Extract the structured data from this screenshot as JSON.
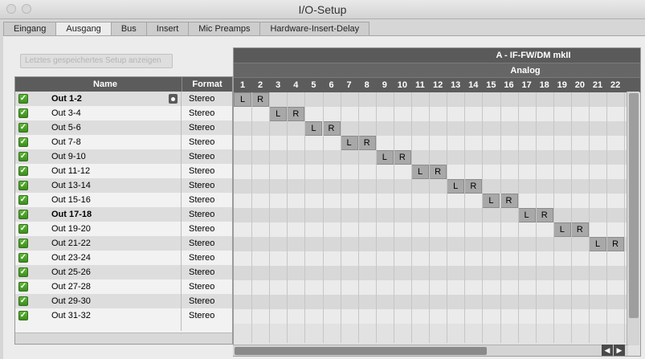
{
  "window": {
    "title": "I/O-Setup"
  },
  "tabs": [
    "Eingang",
    "Ausgang",
    "Bus",
    "Insert",
    "Mic Preamps",
    "Hardware-Insert-Delay"
  ],
  "active_tab": "Ausgang",
  "setup_button": {
    "label": "Letztes gespeichertes Setup anzeigen"
  },
  "table": {
    "col_name": "Name",
    "col_format": "Format",
    "rows": [
      {
        "name": "Out 1-2",
        "format": "Stereo",
        "bold": true,
        "locked": true,
        "checked": true
      },
      {
        "name": "Out 3-4",
        "format": "Stereo",
        "bold": false,
        "locked": false,
        "checked": true
      },
      {
        "name": "Out 5-6",
        "format": "Stereo",
        "bold": false,
        "locked": false,
        "checked": true
      },
      {
        "name": "Out 7-8",
        "format": "Stereo",
        "bold": false,
        "locked": false,
        "checked": true
      },
      {
        "name": "Out 9-10",
        "format": "Stereo",
        "bold": false,
        "locked": false,
        "checked": true
      },
      {
        "name": "Out 11-12",
        "format": "Stereo",
        "bold": false,
        "locked": false,
        "checked": true
      },
      {
        "name": "Out 13-14",
        "format": "Stereo",
        "bold": false,
        "locked": false,
        "checked": true
      },
      {
        "name": "Out 15-16",
        "format": "Stereo",
        "bold": false,
        "locked": false,
        "checked": true
      },
      {
        "name": "Out 17-18",
        "format": "Stereo",
        "bold": true,
        "locked": false,
        "checked": true
      },
      {
        "name": "Out 19-20",
        "format": "Stereo",
        "bold": false,
        "locked": false,
        "checked": true
      },
      {
        "name": "Out 21-22",
        "format": "Stereo",
        "bold": false,
        "locked": false,
        "checked": true
      },
      {
        "name": "Out 23-24",
        "format": "Stereo",
        "bold": false,
        "locked": false,
        "checked": true
      },
      {
        "name": "Out 25-26",
        "format": "Stereo",
        "bold": false,
        "locked": false,
        "checked": true
      },
      {
        "name": "Out 27-28",
        "format": "Stereo",
        "bold": false,
        "locked": false,
        "checked": true
      },
      {
        "name": "Out 29-30",
        "format": "Stereo",
        "bold": false,
        "locked": false,
        "checked": true
      },
      {
        "name": "Out 31-32",
        "format": "Stereo",
        "bold": false,
        "locked": false,
        "checked": true
      }
    ]
  },
  "grid": {
    "device": "A - IF-FW/DM mkII",
    "group": "Analog",
    "channels": [
      "1",
      "2",
      "3",
      "4",
      "5",
      "6",
      "7",
      "8",
      "9",
      "10",
      "11",
      "12",
      "13",
      "14",
      "15",
      "16",
      "17",
      "18",
      "19",
      "20",
      "21",
      "22"
    ],
    "left_label": "L",
    "right_label": "R",
    "assignments": [
      {
        "row": 0,
        "l": 1,
        "r": 2
      },
      {
        "row": 1,
        "l": 3,
        "r": 4
      },
      {
        "row": 2,
        "l": 5,
        "r": 6
      },
      {
        "row": 3,
        "l": 7,
        "r": 8
      },
      {
        "row": 4,
        "l": 9,
        "r": 10
      },
      {
        "row": 5,
        "l": 11,
        "r": 12
      },
      {
        "row": 6,
        "l": 13,
        "r": 14
      },
      {
        "row": 7,
        "l": 15,
        "r": 16
      },
      {
        "row": 8,
        "l": 17,
        "r": 18
      },
      {
        "row": 9,
        "l": 19,
        "r": 20
      },
      {
        "row": 10,
        "l": 21,
        "r": 22
      }
    ]
  },
  "icons": {
    "check": "checkmark-icon",
    "lock": "lock-icon",
    "scroll_left": "arrow-left-icon",
    "scroll_right": "arrow-right-icon"
  }
}
